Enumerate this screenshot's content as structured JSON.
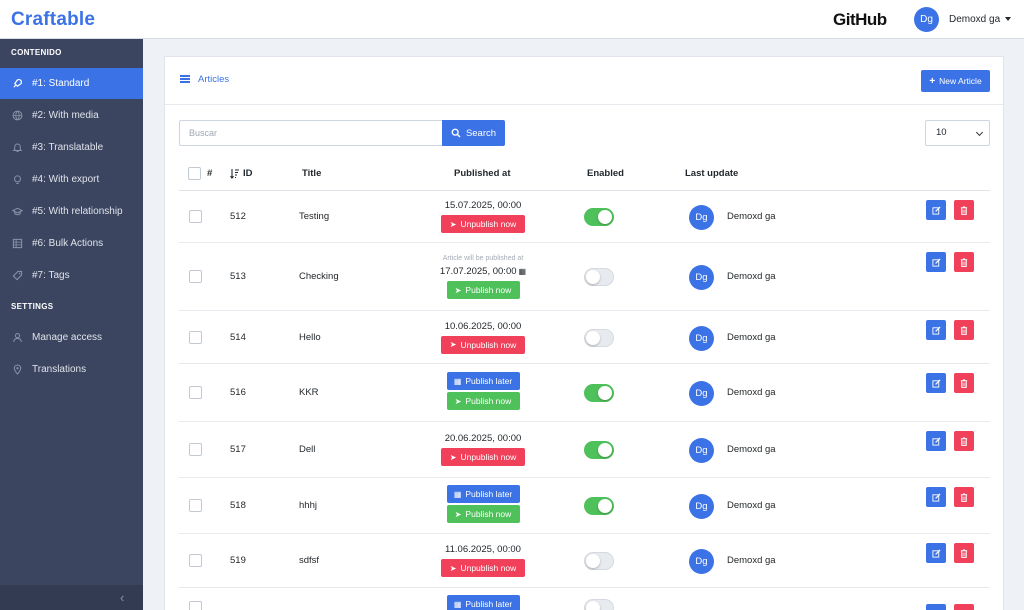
{
  "header": {
    "brand": "Craftable",
    "github": "GitHub",
    "user_initials": "Dg",
    "user_name": "Demoxd ga"
  },
  "sidebar": {
    "section1": "CONTENIDO",
    "section2": "SETTINGS",
    "items": [
      {
        "label": "#1: Standard",
        "icon": "rocket-icon"
      },
      {
        "label": "#2: With media",
        "icon": "globe-icon"
      },
      {
        "label": "#3: Translatable",
        "icon": "bell-icon"
      },
      {
        "label": "#4: With export",
        "icon": "bulb-icon"
      },
      {
        "label": "#5: With relationship",
        "icon": "graduation-cap-icon"
      },
      {
        "label": "#6: Bulk Actions",
        "icon": "grid-icon"
      },
      {
        "label": "#7: Tags",
        "icon": "tag-icon"
      }
    ],
    "settings_items": [
      {
        "label": "Manage access",
        "icon": "user-icon"
      },
      {
        "label": "Translations",
        "icon": "location-icon"
      }
    ]
  },
  "card": {
    "title": "Articles",
    "new_button": "New Article",
    "search_placeholder": "Buscar",
    "search_button": "Search",
    "per_page": "10"
  },
  "table": {
    "headers": {
      "hash": "#",
      "id": "ID",
      "title": "Title",
      "published": "Published at",
      "enabled": "Enabled",
      "updated": "Last update"
    },
    "rows": [
      {
        "id": "512",
        "title": "Testing",
        "date": "15.07.2025, 00:00",
        "note": "",
        "buttons": [
          "Unpublish now"
        ],
        "enabled": true,
        "initials": "Dg",
        "user": "Demoxd ga"
      },
      {
        "id": "513",
        "title": "Checking",
        "date": "17.07.2025, 00:00",
        "note": "Article will be published at",
        "buttons": [
          "Publish now"
        ],
        "enabled": false,
        "initials": "Dg",
        "user": "Demoxd ga"
      },
      {
        "id": "514",
        "title": "Hello",
        "date": "10.06.2025, 00:00",
        "note": "",
        "buttons": [
          "Unpublish now"
        ],
        "enabled": false,
        "initials": "Dg",
        "user": "Demoxd ga"
      },
      {
        "id": "516",
        "title": "KKR",
        "date": "",
        "note": "",
        "buttons": [
          "Publish later",
          "Publish now"
        ],
        "enabled": true,
        "initials": "Dg",
        "user": "Demoxd ga"
      },
      {
        "id": "517",
        "title": "Dell",
        "date": "20.06.2025, 00:00",
        "note": "",
        "buttons": [
          "Unpublish now"
        ],
        "enabled": true,
        "initials": "Dg",
        "user": "Demoxd ga"
      },
      {
        "id": "518",
        "title": "hhhj",
        "date": "",
        "note": "",
        "buttons": [
          "Publish later",
          "Publish now"
        ],
        "enabled": true,
        "initials": "Dg",
        "user": "Demoxd ga"
      },
      {
        "id": "519",
        "title": "sdfsf",
        "date": "11.06.2025, 00:00",
        "note": "",
        "buttons": [
          "Unpublish now"
        ],
        "enabled": false,
        "initials": "Dg",
        "user": "Demoxd ga"
      },
      {
        "id": "",
        "title": "",
        "date": "",
        "note": "",
        "buttons": [
          "Publish later"
        ],
        "enabled": false,
        "initials": "",
        "user": ""
      }
    ]
  },
  "colors": {
    "primary": "#3b73e6",
    "danger": "#f0405a",
    "success": "#4fc15a",
    "sidebar": "#3b4560"
  }
}
